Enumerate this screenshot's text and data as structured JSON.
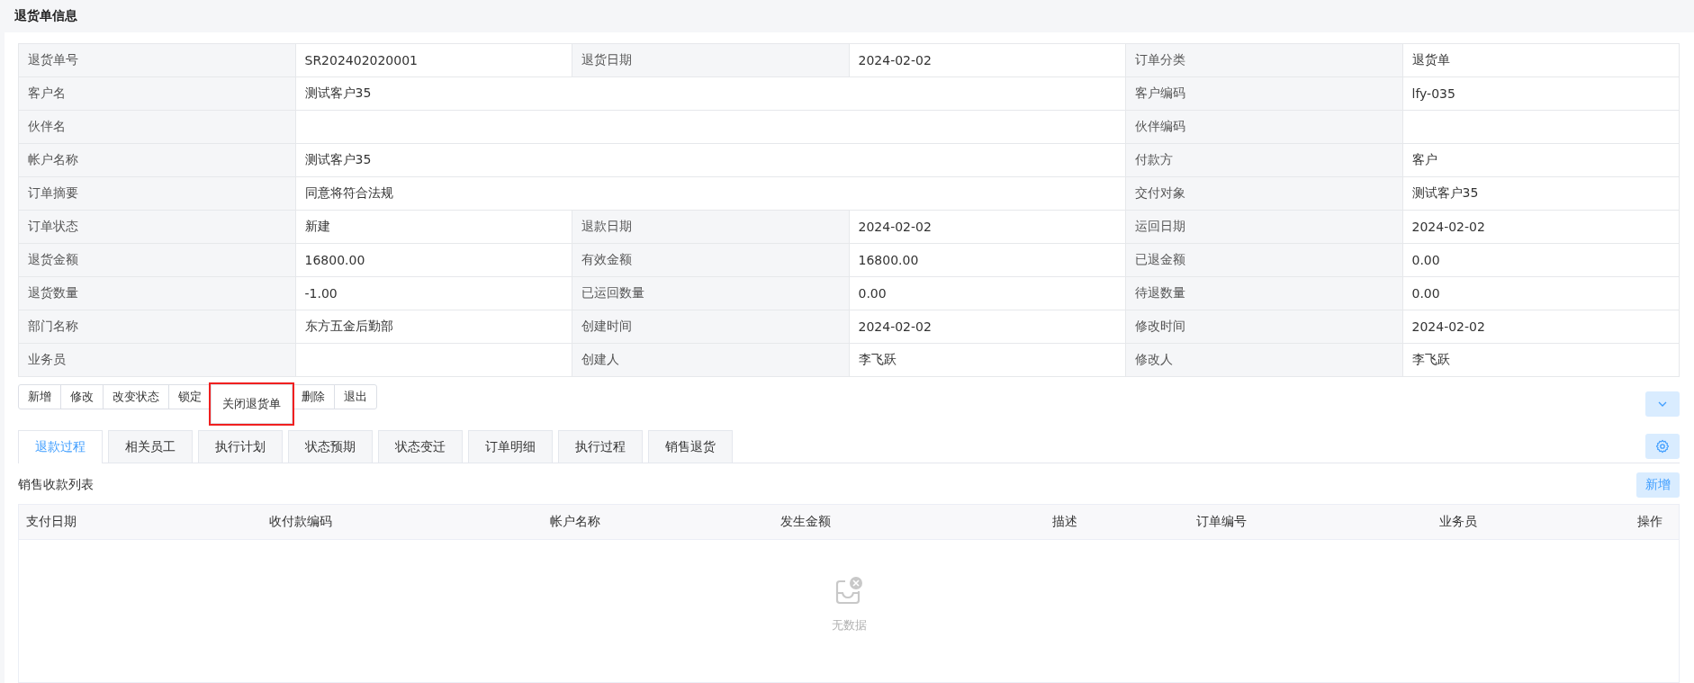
{
  "header": {
    "title": "退货单信息"
  },
  "details": [
    [
      {
        "label": "退货单号",
        "value": "SR202402020001"
      },
      {
        "label": "退货日期",
        "value": "2024-02-02"
      },
      {
        "label": "订单分类",
        "value": "退货单"
      }
    ],
    [
      {
        "label": "客户名",
        "value": "测试客户35",
        "wide": true
      },
      {
        "label": "客户编码",
        "value": "lfy-035"
      }
    ],
    [
      {
        "label": "伙伴名",
        "wide": true
      },
      {
        "label": "伙伴编码"
      }
    ],
    [
      {
        "label": "帐户名称",
        "value": "测试客户35",
        "wide": true
      },
      {
        "label": "付款方",
        "value": "客户"
      }
    ],
    [
      {
        "label": "订单摘要",
        "value": "同意将符合法规",
        "wide": true
      },
      {
        "label": "交付对象",
        "value": "测试客户35"
      }
    ],
    [
      {
        "label": "订单状态",
        "value": "新建"
      },
      {
        "label": "退款日期",
        "value": "2024-02-02"
      },
      {
        "label": "运回日期",
        "value": "2024-02-02"
      }
    ],
    [
      {
        "label": "退货金额",
        "value": "16800.00"
      },
      {
        "label": "有效金额",
        "value": "16800.00"
      },
      {
        "label": "已退金额",
        "value": "0.00"
      }
    ],
    [
      {
        "label": "退货数量",
        "value": "-1.00"
      },
      {
        "label": "已运回数量",
        "value": "0.00"
      },
      {
        "label": "待退数量",
        "value": "0.00"
      }
    ],
    [
      {
        "label": "部门名称",
        "value": "东方五金后勤部"
      },
      {
        "label": "创建时间",
        "value": "2024-02-02"
      },
      {
        "label": "修改时间",
        "value": "2024-02-02"
      }
    ],
    [
      {
        "label": "业务员"
      },
      {
        "label": "创建人",
        "value": "李飞跃"
      },
      {
        "label": "修改人",
        "value": "李飞跃"
      }
    ]
  ],
  "actions": [
    {
      "label": "新增",
      "highlighted": false
    },
    {
      "label": "修改",
      "highlighted": false
    },
    {
      "label": "改变状态",
      "highlighted": false
    },
    {
      "label": "锁定",
      "highlighted": false
    },
    {
      "label": "关闭退货单",
      "highlighted": true
    },
    {
      "label": "删除",
      "highlighted": false
    },
    {
      "label": "退出",
      "highlighted": false
    }
  ],
  "tabs": [
    {
      "label": "退款过程",
      "selected": true
    },
    {
      "label": "相关员工",
      "selected": false
    },
    {
      "label": "执行计划",
      "selected": false
    },
    {
      "label": "状态预期",
      "selected": false
    },
    {
      "label": "状态变迁",
      "selected": false
    },
    {
      "label": "订单明细",
      "selected": false
    },
    {
      "label": "执行过程",
      "selected": false
    },
    {
      "label": "销售退货",
      "selected": false
    }
  ],
  "list": {
    "title": "销售收款列表",
    "add_button": "新增",
    "columns": [
      "支付日期",
      "收付款编码",
      "帐户名称",
      "发生金额",
      "描述",
      "订单编号",
      "业务员",
      "操作"
    ],
    "empty_text": "无数据"
  }
}
